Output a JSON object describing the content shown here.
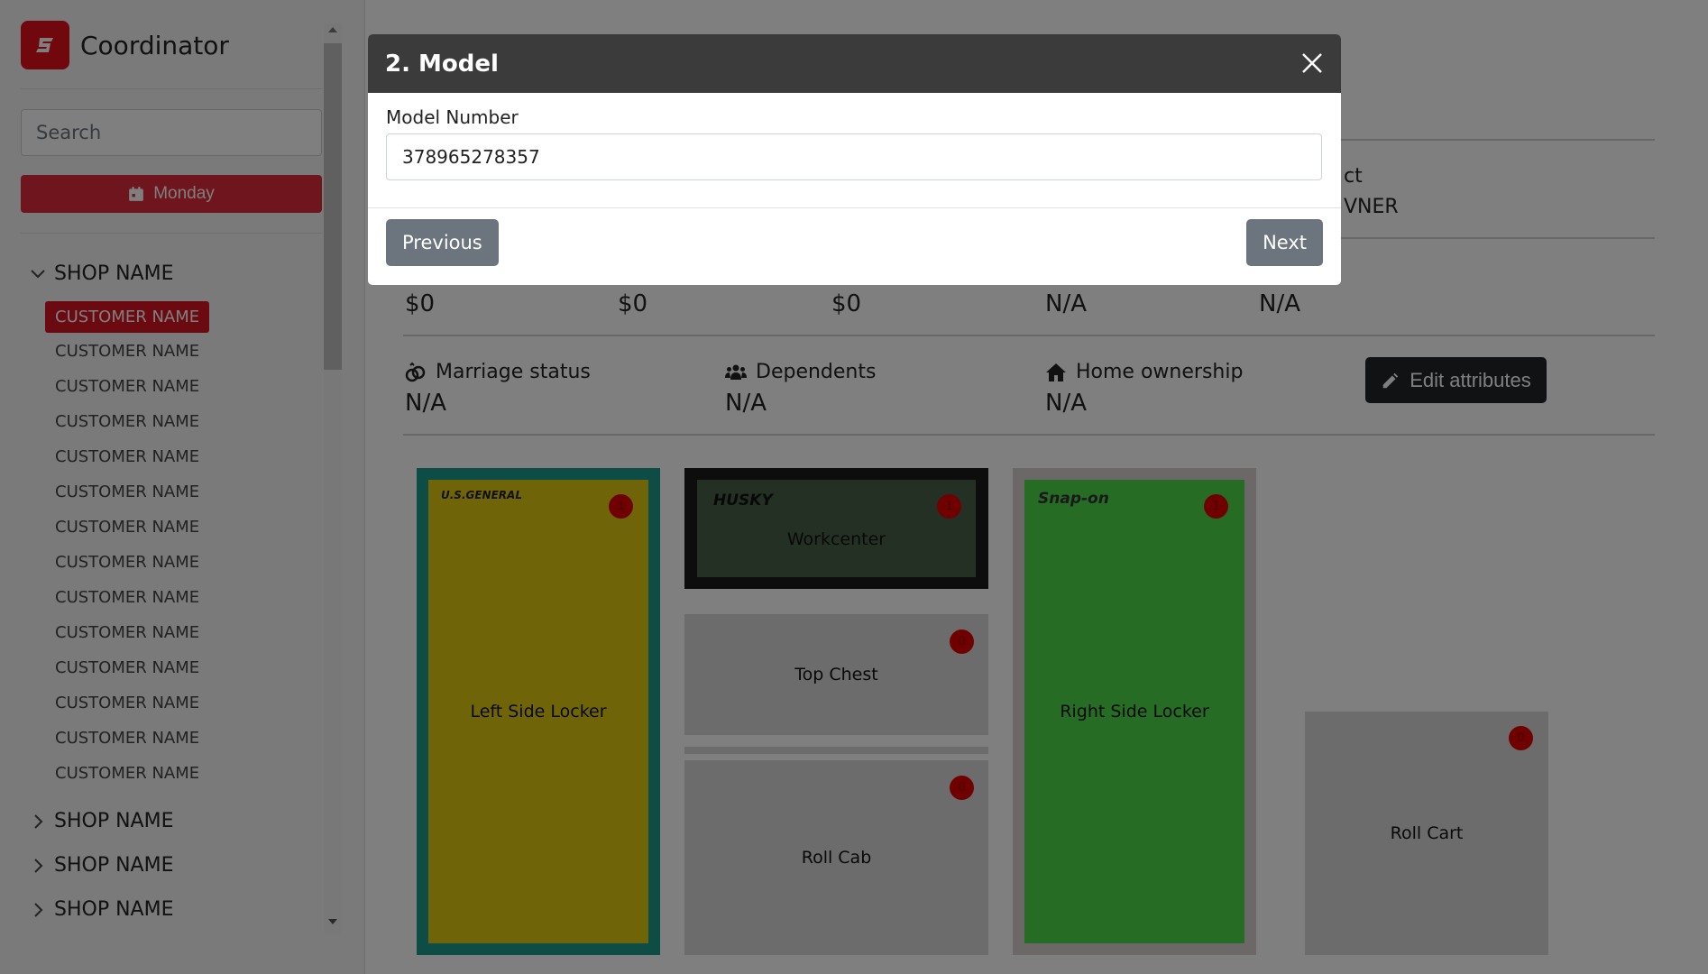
{
  "app": {
    "title": "Coordinator"
  },
  "sidebar": {
    "search_placeholder": "Search",
    "day_button": "Monday",
    "shops": [
      {
        "name": "SHOP NAME",
        "expanded": true,
        "customers": [
          "CUSTOMER NAME",
          "CUSTOMER NAME",
          "CUSTOMER NAME",
          "CUSTOMER NAME",
          "CUSTOMER NAME",
          "CUSTOMER NAME",
          "CUSTOMER NAME",
          "CUSTOMER NAME",
          "CUSTOMER NAME",
          "CUSTOMER NAME",
          "CUSTOMER NAME",
          "CUSTOMER NAME",
          "CUSTOMER NAME",
          "CUSTOMER NAME"
        ]
      },
      {
        "name": "SHOP NAME",
        "expanded": false
      },
      {
        "name": "SHOP NAME",
        "expanded": false
      },
      {
        "name": "SHOP NAME",
        "expanded": false
      }
    ]
  },
  "main": {
    "partial_header_1": "ct",
    "partial_header_2": "VNER",
    "money_values": [
      "$0",
      "$0",
      "$0",
      "N/A",
      "N/A"
    ],
    "attributes": [
      {
        "label": "Marriage status",
        "value": "N/A",
        "icon": "rings-icon"
      },
      {
        "label": "Dependents",
        "value": "N/A",
        "icon": "users-icon"
      },
      {
        "label": "Home ownership",
        "value": "N/A",
        "icon": "home-icon"
      }
    ],
    "edit_button": "Edit attributes",
    "boxes": {
      "left_locker": {
        "label": "Left Side Locker",
        "brand": "U.S.GENERAL",
        "badge": "1",
        "color": "#e0c810",
        "border": "#1a9a8c"
      },
      "workcenter": {
        "label": "Workcenter",
        "brand": "HUSKY",
        "badge": "1",
        "color": "#4a6048"
      },
      "top_chest": {
        "label": "Top Chest",
        "badge": "0"
      },
      "roll_cab": {
        "label": "Roll Cab",
        "badge": "0"
      },
      "right_locker": {
        "label": "Right Side Locker",
        "brand": "Snap-on",
        "badge": "1",
        "color": "#4fd84a"
      },
      "roll_cart": {
        "label": "Roll Cart",
        "badge": "0"
      }
    }
  },
  "modal": {
    "title": "2. Model",
    "field_label": "Model Number",
    "field_value": "378965278357",
    "previous_button": "Previous",
    "next_button": "Next"
  }
}
